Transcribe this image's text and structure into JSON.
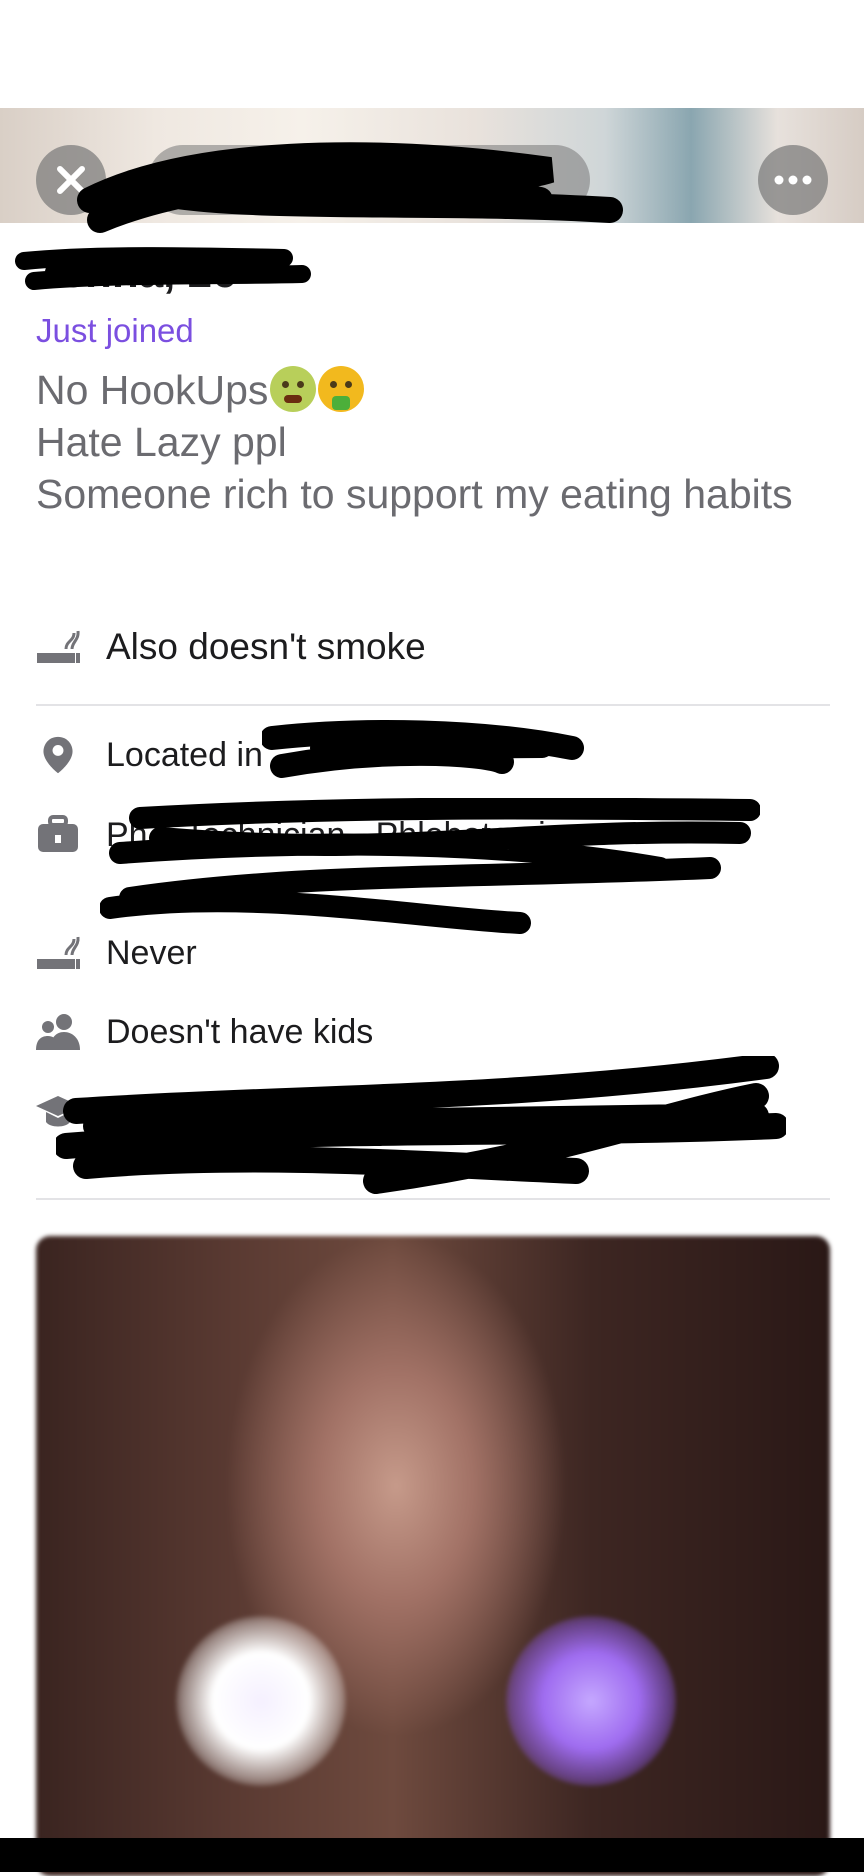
{
  "profile": {
    "name_age": "Jenna, 26",
    "status": "Just joined",
    "bio": [
      "No HookUps",
      "Hate Lazy ppl",
      "Someone rich to support my eating habits"
    ]
  },
  "highlight": {
    "smoking": "Also doesn't smoke"
  },
  "details": {
    "location": "Located in",
    "work": "Ph... Technician - Phlebotomi...",
    "smoking": "Never",
    "kids": "Doesn't have kids",
    "education": "..."
  },
  "icons": {
    "close": "close-icon",
    "more": "more-icon",
    "cigarette": "no-smoking-icon",
    "location": "location-pin-icon",
    "work": "briefcase-icon",
    "kids": "people-icon",
    "education": "graduation-cap-icon"
  },
  "colors": {
    "accent": "#7b4fe0",
    "text": "#1c1c1e",
    "muted": "#6b6b70",
    "icon": "#737378"
  }
}
